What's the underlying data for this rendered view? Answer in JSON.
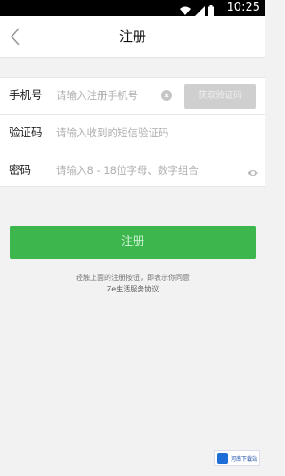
{
  "status_bar": {
    "time": "10:25",
    "icons": [
      "wifi-icon",
      "signal-icon",
      "battery-icon"
    ]
  },
  "header": {
    "title": "注册",
    "back_icon": "chevron-left-icon"
  },
  "form": {
    "phone": {
      "label": "手机号",
      "placeholder": "请输入注册手机号",
      "clear_icon": "clear-icon",
      "code_button": "获取验证码"
    },
    "code": {
      "label": "验证码",
      "placeholder": "请输入收到的短信验证码"
    },
    "password": {
      "label": "密码",
      "placeholder": "请输入8 - 18位字母、数字组合",
      "toggle_icon": "eye-icon"
    }
  },
  "submit_label": "注册",
  "agreement": {
    "text": "轻触上面的注册按钮，即表示你同意",
    "link": "Ze生活服务协议"
  },
  "watermark": {
    "text": "河南下载站"
  },
  "colors": {
    "accent": "#3cb64d",
    "disabled_button": "#cfcfcf"
  }
}
